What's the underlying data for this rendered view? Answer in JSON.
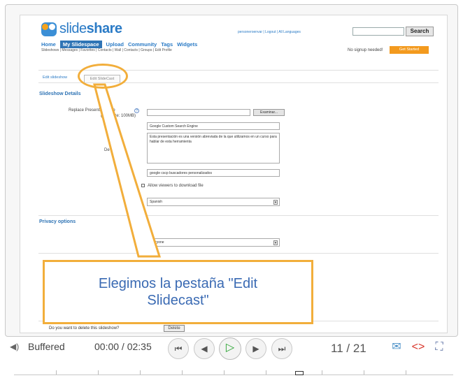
{
  "site": {
    "logo_text_light": "slide",
    "logo_text_bold": "share",
    "top_links": "personeroenvar | Logout | All Languages",
    "search_placeholder": "",
    "search_button": "Search",
    "nav": [
      "Home",
      "My Slidespace",
      "Upload",
      "Community",
      "Tags",
      "Widgets"
    ],
    "active_nav": "My Slidespace",
    "subnav": "Slideshows | Messages | Favorites | Contacts | Wall | Contacts | Groups | Edit Profile",
    "no_signup": "No signup needed!",
    "get_started": "Get Started"
  },
  "tabs": {
    "edit_slideshow": "Edit slideshow",
    "edit_slidecast": "Edit SlideCast"
  },
  "details": {
    "section_title": "Slideshow Details",
    "replace_label": "Replace Presentation file",
    "replace_sublabel": "(max size: 100MB)",
    "browse_button": "Examinar...",
    "title_value": "Google Custom Search Engine",
    "description_value": "Esta presentación es una  versión abreviada de la que utilizamos en un curso para hablar de esta herramienta",
    "description_link": "herramienta",
    "description_label": "De",
    "tags_value": "google cscp buscadores personalizados",
    "allow_download": "Allow viewers to download file",
    "language_value": "Spanish"
  },
  "privacy": {
    "section_title": "Privacy options",
    "visibility_value": "everyone"
  },
  "delete": {
    "question": "Do you want to delete this slideshow?",
    "button": "Delete"
  },
  "annotation": {
    "callout_text": "Elegimos la pestaña \"Edit Slidecast\""
  },
  "player": {
    "status": "Buffered",
    "time": "00:00 / 02:35",
    "page": "11 / 21",
    "colors": {
      "accent": "#f2ae3b",
      "play": "#2aa532",
      "brand": "#2b7bc6"
    },
    "icons": [
      "volume-icon",
      "first-slide-icon",
      "previous-icon",
      "play-icon",
      "next-icon",
      "last-slide-icon",
      "email-icon",
      "embed-icon",
      "fullscreen-icon"
    ]
  }
}
